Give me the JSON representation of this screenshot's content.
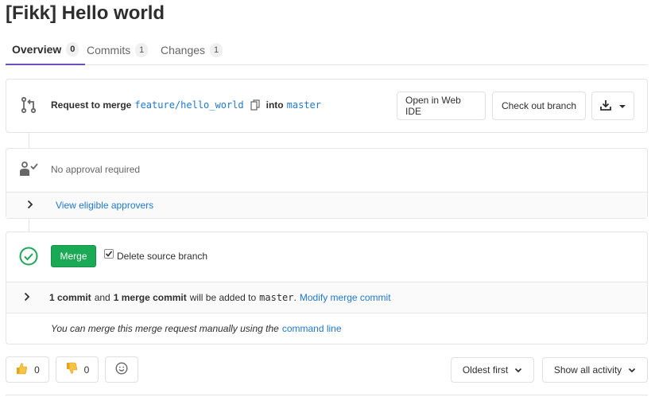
{
  "title": "[Fikk] Hello world",
  "tabs": [
    {
      "label": "Overview",
      "count": "0"
    },
    {
      "label": "Commits",
      "count": "1"
    },
    {
      "label": "Changes",
      "count": "1"
    }
  ],
  "merge_request": {
    "request_label": "Request to merge",
    "source_branch": "feature/hello_world",
    "into_label": "into",
    "target_branch": "master",
    "open_web_ide": "Open in Web IDE",
    "check_out_branch": "Check out branch"
  },
  "approval": {
    "status": "No approval required",
    "view_approvers": "View eligible approvers"
  },
  "merge": {
    "button_label": "Merge",
    "delete_source_label": "Delete source branch",
    "delete_source_checked": true,
    "commit_count": "1 commit",
    "and_text": "and",
    "merge_commit_count": "1 merge commit",
    "added_text": "will be added to",
    "target_branch": "master",
    "modify_link": "Modify merge commit",
    "manual_text": "You can merge this merge request manually using the",
    "command_line_link": "command line"
  },
  "reactions": {
    "thumbs_up_count": "0",
    "thumbs_down_count": "0"
  },
  "sort": {
    "order_label": "Oldest first",
    "filter_label": "Show all activity"
  },
  "colors": {
    "accent": "#6b4fbb",
    "success": "#1aaa55",
    "link": "#1f78d1"
  }
}
